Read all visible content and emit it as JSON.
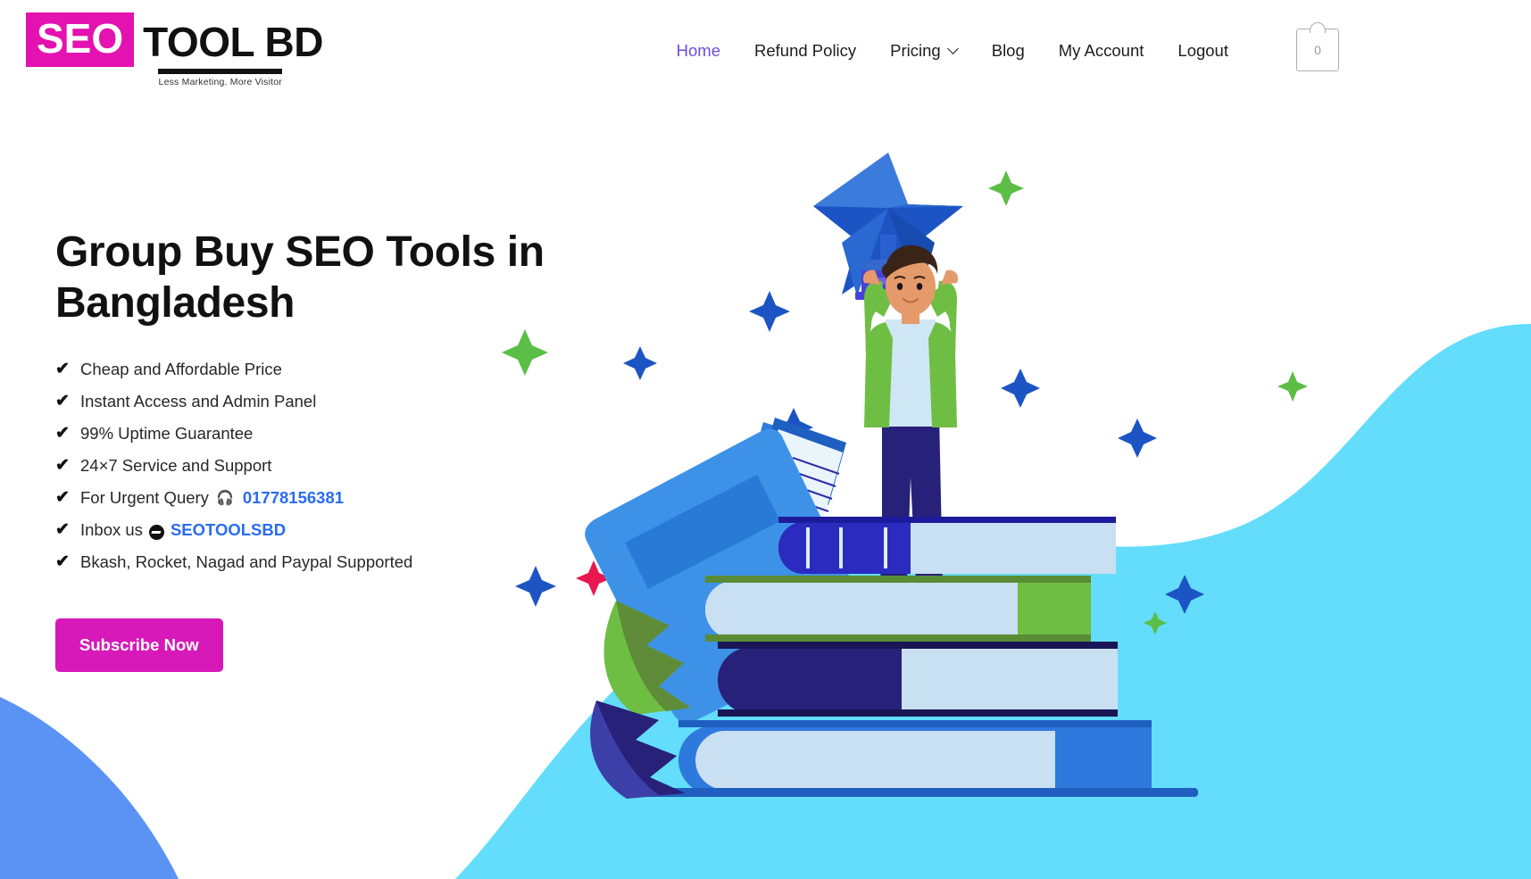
{
  "header": {
    "logo": {
      "seo_text": "SEO",
      "tool_text": "TOOL BD",
      "tagline": "Less Marketing. More Visitor"
    },
    "nav": [
      {
        "label": "Home",
        "active": true,
        "has_dropdown": false
      },
      {
        "label": "Refund Policy",
        "active": false,
        "has_dropdown": false
      },
      {
        "label": "Pricing",
        "active": false,
        "has_dropdown": true
      },
      {
        "label": "Blog",
        "active": false,
        "has_dropdown": false
      },
      {
        "label": "My Account",
        "active": false,
        "has_dropdown": false
      },
      {
        "label": "Logout",
        "active": false,
        "has_dropdown": false
      }
    ],
    "cart": {
      "icon": "shopping-bag-icon",
      "count": "0"
    }
  },
  "hero": {
    "title": "Group Buy SEO Tools in Bangladesh",
    "features": [
      {
        "text": "Cheap and Affordable Price"
      },
      {
        "text": "Instant Access and Admin Panel"
      },
      {
        "text": "99% Uptime Guarantee"
      },
      {
        "text": "24×7 Service and Support"
      },
      {
        "text": "For Urgent Query",
        "icon": "headset-icon",
        "link": "01778156381"
      },
      {
        "text": "Inbox us",
        "icon": "messenger-icon",
        "link": "SEOTOOLSBD"
      },
      {
        "text": "Bkash, Rocket, Nagad and Paypal Supported"
      }
    ],
    "cta_label": "Subscribe Now"
  },
  "colors": {
    "brand_magenta": "#D619B8",
    "logo_magenta": "#E312B0",
    "active_nav_purple": "#6C4BE0",
    "link_blue": "#2a6bf2",
    "blob_cyan": "#63DDFB",
    "corner_blue": "#5B93F5",
    "jacket_green": "#6FBE44",
    "book_navy": "#27217A",
    "book_blue": "#2E79DE",
    "star_blue": "#1D54C4",
    "sparkle_green": "#5BBE46",
    "sparkle_pink": "#E8174E"
  },
  "illustration": {
    "name": "student-holding-star-trophy-on-books",
    "elements": [
      "cyan-blob",
      "corner-blue-curve",
      "star-trophy",
      "boy-character",
      "book-stack",
      "leaves",
      "sparkles"
    ]
  }
}
